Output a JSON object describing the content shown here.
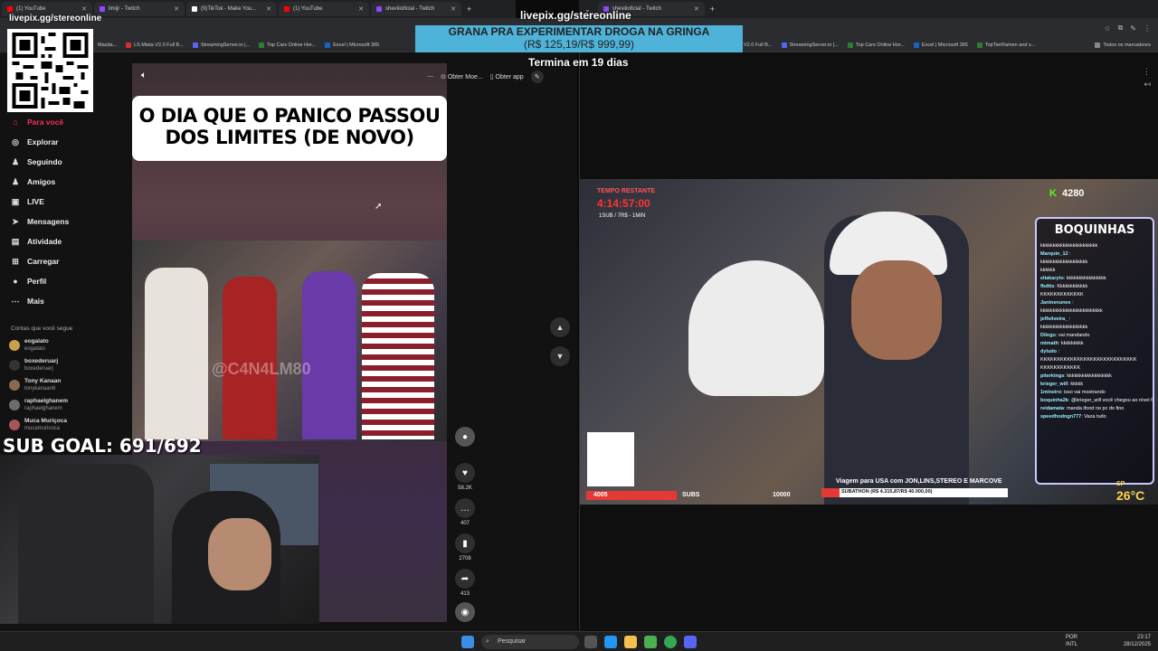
{
  "left_browser": {
    "tabs": [
      {
        "label": "(1) YouTube",
        "color": "#ff0000"
      },
      {
        "label": "limijr - Twitch",
        "color": "#9146ff"
      },
      {
        "label": "(9)TikTok - Make You...",
        "color": "#ffffff"
      },
      {
        "label": "(1) YouTube",
        "color": "#ff0000"
      },
      {
        "label": "sheviiioficial - Twitch",
        "color": "#9146ff"
      }
    ],
    "bookmarks": [
      "Mazda...",
      "LS Miata V2.0 Full B...",
      "StreamingServer.io |...",
      "Top Cars Online Hor...",
      "Excel | Microsoft 365"
    ]
  },
  "right_browser": {
    "tabs": [
      {
        "label": "sheviiioficial - Twitch",
        "color": "#9146ff"
      }
    ],
    "bookmarks": [
      "V2.0 Full B...",
      "StreamingServer.io |...",
      "Top Cars Online Hor...",
      "Excel | Microsoft 365",
      "TopTierRamen and s...",
      "Todos os marcadores"
    ]
  },
  "overlay": {
    "channel_top": "livepix.gg/stereonline",
    "livepix_center": "livepix.gg/stereonline",
    "banner_title": "GRANA PRA EXPERIMENTAR DROGA NA GRINGA",
    "banner_amount": "(R$ 125,19/R$ 999,99)",
    "termina": "Termina em 19 dias",
    "sub_goal": "SUB GOAL: 691/692"
  },
  "sidebar": {
    "nav": [
      {
        "label": "Para você",
        "icon": "home-icon",
        "glyph": "⌂",
        "active": true
      },
      {
        "label": "Explorar",
        "icon": "compass-icon",
        "glyph": "◎"
      },
      {
        "label": "Seguindo",
        "icon": "person-icon",
        "glyph": "♟"
      },
      {
        "label": "Amigos",
        "icon": "people-icon",
        "glyph": "♟"
      },
      {
        "label": "LIVE",
        "icon": "live-icon",
        "glyph": "▣"
      },
      {
        "label": "Mensagens",
        "icon": "send-icon",
        "glyph": "➤"
      },
      {
        "label": "Atividade",
        "icon": "inbox-icon",
        "glyph": "▤"
      },
      {
        "label": "Carregar",
        "icon": "plus-icon",
        "glyph": "⊞"
      },
      {
        "label": "Perfil",
        "icon": "avatar-icon",
        "glyph": "●"
      },
      {
        "label": "Mais",
        "icon": "more-icon",
        "glyph": "⋯"
      }
    ],
    "following_header": "Contas que você segue",
    "following": [
      {
        "name": "eogalato",
        "handle": "eogalato"
      },
      {
        "name": "boxederuarj",
        "handle": "boxederuarj"
      },
      {
        "name": "Tony Kanaan",
        "handle": "tonykanaan6"
      },
      {
        "name": "raphaelghanem",
        "handle": "raphaelghanem"
      },
      {
        "name": "Muca Muriçoca",
        "handle": "mucamuricoca"
      }
    ]
  },
  "video": {
    "title": "O DIA QUE O PANICO PASSOU DOS LIMITES (DE NOVO)",
    "watermark": "@C4N4LM80",
    "toolbar": {
      "more": "⋯",
      "get_coins": "Obter Moe...",
      "get_app": "Obter app"
    },
    "actions": {
      "likes": "58.2K",
      "comments": "407",
      "saves": "2708",
      "shares": "413"
    }
  },
  "stream": {
    "timer_label": "TEMPO RESTANTE",
    "timer_value": "4:14:57:00",
    "timer_sub": "1SUB / 7R$ - 1MIN",
    "kick_label": "K",
    "viewers": "4280",
    "chat_title": "BOQUINHAS",
    "chat": [
      {
        "user": "",
        "msg": "kkkkkkkkkkkkkkkkkkkkkkk"
      },
      {
        "user": "Marquin_12",
        "msg": ""
      },
      {
        "user": "",
        "msg": "kkkkkkkkkkkkkkkkkkk"
      },
      {
        "user": "",
        "msg": "kkkkkk"
      },
      {
        "user": "eliakaryto",
        "msg": "kkkkkkkkkkkkkkkk"
      },
      {
        "user": "fbdtts",
        "msg": "Kkkkkkkkkkkk"
      },
      {
        "user": "",
        "msg": "KKKKKKKKKKKKK"
      },
      {
        "user": "Janinenunes",
        "msg": ""
      },
      {
        "user": "",
        "msg": "kkkkkkkkkkkkkkkkkkkkkkkkk"
      },
      {
        "user": "jeffsilveira_",
        "msg": ""
      },
      {
        "user": "",
        "msg": "kkkkkkkkkkkkkkkkkkk"
      },
      {
        "user": "Dilegu",
        "msg": "vai mandando"
      },
      {
        "user": "mtmath",
        "msg": "kkkkkkkkk"
      },
      {
        "user": "dyludo",
        "msg": ""
      },
      {
        "user": "",
        "msg": "KKKKKKKKKKKKKKKKKKKKKKKKKKKKK"
      },
      {
        "user": "",
        "msg": "KKKKKKKKKKKK"
      },
      {
        "user": "piterkings",
        "msg": "kkkkkkkkkkkkkkkkkk"
      },
      {
        "user": "krieger_will",
        "msg": "kkkkk"
      },
      {
        "user": "1mineiro",
        "msg": "isso vai mostrando"
      },
      {
        "user": "boquinha2k",
        "msg": "@krieger_will você chegou ao nível 6"
      },
      {
        "user": "reidamata",
        "msg": "manda ifood no pc do fino"
      },
      {
        "user": "speedhodngn777",
        "msg": "Vaza tudo"
      }
    ],
    "sub_bar": {
      "left": "4005",
      "label": "SUBS",
      "right": "10000"
    },
    "viagem": "Viagem para USA com JON,LINS,STEREO E MARCOVE",
    "subathon": "SUBATHON (R$ 4.315,87/R$ 40.000,00)",
    "temperature": "26°C",
    "temp_label": "SP"
  },
  "taskbar": {
    "search_placeholder": "Pesquisar",
    "lang": "POR",
    "lang2": "INTL",
    "time": "23:17",
    "date": "28/12/2025"
  }
}
